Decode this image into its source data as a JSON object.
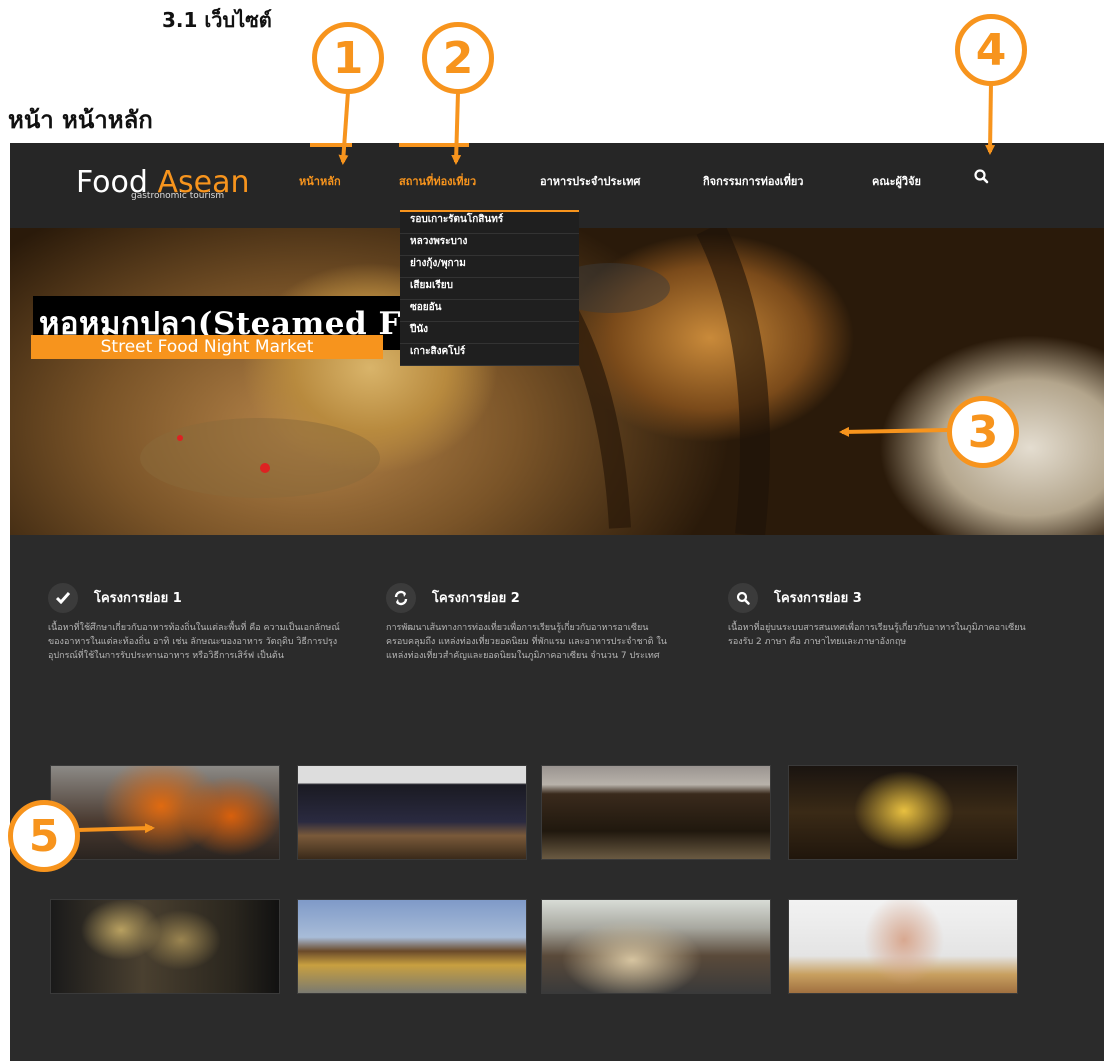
{
  "doc": {
    "heading": "3.1 เว็บไซต์",
    "page_label": "หน้า หน้าหลัก"
  },
  "site": {
    "logo": {
      "food": "Food",
      "asean": "Asean",
      "tagline": "gastronomic tourism"
    },
    "nav": [
      {
        "label": "หน้าหลัก"
      },
      {
        "label": "สถานที่ท่องเที่ยว"
      },
      {
        "label": "อาหารประจำประเทศ"
      },
      {
        "label": "กิจกรรมการท่องเที่ยว"
      },
      {
        "label": "คณะผู้วิจัย"
      }
    ],
    "search_icon": "search-icon",
    "dropdown": [
      "รอบเกาะรัตนโกสินทร์",
      "หลวงพระบาง",
      "ย่างกุ้ง/พุกาม",
      "เสียมเรียบ",
      "ซอยอัน",
      "ปีนัง",
      "เกาะสิงคโปร์"
    ],
    "hero": {
      "title": "หอหมกปลา(Steamed        Fish)",
      "subtitle": "Street Food Night Market"
    },
    "features": [
      {
        "icon": "check-icon",
        "title": "โครงการย่อย 1",
        "text": "เนื้อหาที่ใช้ศึกษาเกี่ยวกับอาหารท้องถิ่นในแต่ละพื้นที่ คือ ความเป็นเอกลักษณ์ของอาหารในแต่ละท้องถิ่น อาทิ เช่น ลักษณะของอาหาร วัตถุดิบ วิธีการปรุง อุปกรณ์ที่ใช้ในการรับประทานอาหาร หรือวิธีการเสิร์ฟ เป็นต้น"
      },
      {
        "icon": "refresh-icon",
        "title": "โครงการย่อย 2",
        "text": "การพัฒนาเส้นทางการท่องเที่ยวเพื่อการเรียนรู้เกี่ยวกับอาหารอาเซียน ครอบคลุมถึง แหล่งท่องเที่ยวยอดนิยม ที่พักแรม และอาหารประจำชาติ ในแหล่งท่องเที่ยวสำคัญและยอดนิยมในภูมิภาคอาเซียน จำนวน 7 ประเทศ"
      },
      {
        "icon": "search-icon",
        "title": "โครงการย่อย 3",
        "text": "เนื้อหาที่อยู่บนระบบสารสนเทศเพื่อการเรียนรู้เกี่ยวกับอาหารในภูมิภาคอาเซียนรองรับ 2 ภาษา คือ ภาษาไทยและภาษาอังกฤษ"
      }
    ]
  },
  "callouts": [
    "1",
    "2",
    "3",
    "4",
    "5"
  ],
  "colors": {
    "accent": "#f7941d",
    "site_bg": "#2b2b2b",
    "nav_bg": "#262626"
  }
}
